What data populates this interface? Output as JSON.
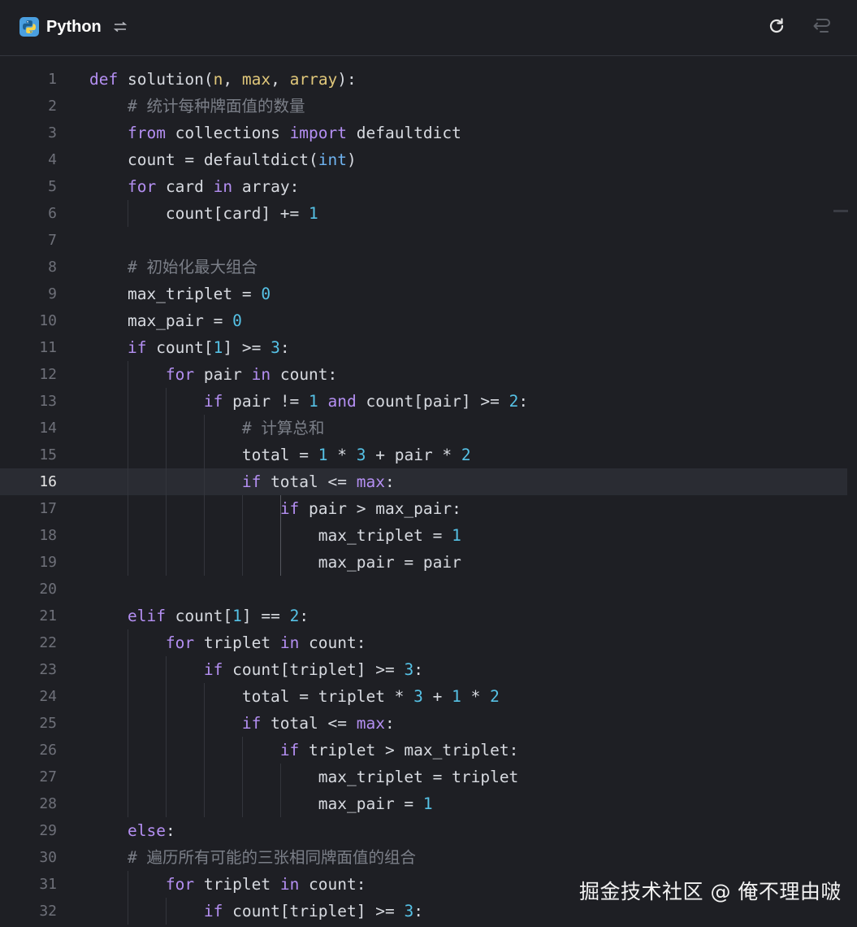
{
  "header": {
    "language": "Python",
    "icons": {
      "language": "python-logo-icon",
      "switch": "swap-icon",
      "refresh": "refresh-icon",
      "wrap": "word-wrap-icon"
    }
  },
  "editor": {
    "active_line": 16,
    "lines": [
      {
        "n": "1",
        "tokens": [
          [
            "k",
            "def "
          ],
          [
            "f",
            "solution("
          ],
          [
            "p",
            "n"
          ],
          [
            "f",
            ", "
          ],
          [
            "p",
            "max"
          ],
          [
            "f",
            ", "
          ],
          [
            "p",
            "array"
          ],
          [
            "f",
            "):"
          ]
        ]
      },
      {
        "n": "2",
        "tokens": [
          [
            "f",
            "    "
          ],
          [
            "c",
            "# 统计每种牌面值的数量"
          ]
        ]
      },
      {
        "n": "3",
        "tokens": [
          [
            "f",
            "    "
          ],
          [
            "k",
            "from"
          ],
          [
            "f",
            " collections "
          ],
          [
            "k",
            "import"
          ],
          [
            "f",
            " defaultdict"
          ]
        ]
      },
      {
        "n": "4",
        "tokens": [
          [
            "f",
            "    count = defaultdict("
          ],
          [
            "b",
            "int"
          ],
          [
            "f",
            ")"
          ]
        ]
      },
      {
        "n": "5",
        "tokens": [
          [
            "f",
            "    "
          ],
          [
            "k",
            "for"
          ],
          [
            "f",
            " card "
          ],
          [
            "k",
            "in"
          ],
          [
            "f",
            " array:"
          ]
        ]
      },
      {
        "n": "6",
        "tokens": [
          [
            "f",
            "        count[card] += "
          ],
          [
            "n",
            "1"
          ]
        ]
      },
      {
        "n": "7",
        "tokens": []
      },
      {
        "n": "8",
        "tokens": [
          [
            "f",
            "    "
          ],
          [
            "c",
            "# 初始化最大组合"
          ]
        ]
      },
      {
        "n": "9",
        "tokens": [
          [
            "f",
            "    max_triplet = "
          ],
          [
            "n",
            "0"
          ]
        ]
      },
      {
        "n": "10",
        "tokens": [
          [
            "f",
            "    max_pair = "
          ],
          [
            "n",
            "0"
          ]
        ]
      },
      {
        "n": "11",
        "tokens": [
          [
            "f",
            "    "
          ],
          [
            "k",
            "if"
          ],
          [
            "f",
            " count["
          ],
          [
            "n",
            "1"
          ],
          [
            "f",
            "] >= "
          ],
          [
            "n",
            "3"
          ],
          [
            "f",
            ":"
          ]
        ]
      },
      {
        "n": "12",
        "tokens": [
          [
            "f",
            "        "
          ],
          [
            "k",
            "for"
          ],
          [
            "f",
            " pair "
          ],
          [
            "k",
            "in"
          ],
          [
            "f",
            " count:"
          ]
        ]
      },
      {
        "n": "13",
        "tokens": [
          [
            "f",
            "            "
          ],
          [
            "k",
            "if"
          ],
          [
            "f",
            " pair != "
          ],
          [
            "n",
            "1"
          ],
          [
            "f",
            " "
          ],
          [
            "k",
            "and"
          ],
          [
            "f",
            " count[pair] >= "
          ],
          [
            "n",
            "2"
          ],
          [
            "f",
            ":"
          ]
        ]
      },
      {
        "n": "14",
        "tokens": [
          [
            "f",
            "                "
          ],
          [
            "c",
            "# 计算总和"
          ]
        ]
      },
      {
        "n": "15",
        "tokens": [
          [
            "f",
            "                total = "
          ],
          [
            "n",
            "1"
          ],
          [
            "f",
            " * "
          ],
          [
            "n",
            "3"
          ],
          [
            "f",
            " + pair * "
          ],
          [
            "n",
            "2"
          ]
        ]
      },
      {
        "n": "16",
        "tokens": [
          [
            "f",
            "                "
          ],
          [
            "k",
            "if"
          ],
          [
            "f",
            " total <= "
          ],
          [
            "k",
            "max"
          ],
          [
            "f",
            ":"
          ]
        ]
      },
      {
        "n": "17",
        "tokens": [
          [
            "f",
            "                    "
          ],
          [
            "k",
            "if"
          ],
          [
            "f",
            " pair > max_pair:"
          ]
        ]
      },
      {
        "n": "18",
        "tokens": [
          [
            "f",
            "                        max_triplet = "
          ],
          [
            "n",
            "1"
          ]
        ]
      },
      {
        "n": "19",
        "tokens": [
          [
            "f",
            "                        max_pair = pair"
          ]
        ]
      },
      {
        "n": "20",
        "tokens": []
      },
      {
        "n": "21",
        "tokens": [
          [
            "f",
            "    "
          ],
          [
            "k",
            "elif"
          ],
          [
            "f",
            " count["
          ],
          [
            "n",
            "1"
          ],
          [
            "f",
            "] == "
          ],
          [
            "n",
            "2"
          ],
          [
            "f",
            ":"
          ]
        ]
      },
      {
        "n": "22",
        "tokens": [
          [
            "f",
            "        "
          ],
          [
            "k",
            "for"
          ],
          [
            "f",
            " triplet "
          ],
          [
            "k",
            "in"
          ],
          [
            "f",
            " count:"
          ]
        ]
      },
      {
        "n": "23",
        "tokens": [
          [
            "f",
            "            "
          ],
          [
            "k",
            "if"
          ],
          [
            "f",
            " count[triplet] >= "
          ],
          [
            "n",
            "3"
          ],
          [
            "f",
            ":"
          ]
        ]
      },
      {
        "n": "24",
        "tokens": [
          [
            "f",
            "                total = triplet * "
          ],
          [
            "n",
            "3"
          ],
          [
            "f",
            " + "
          ],
          [
            "n",
            "1"
          ],
          [
            "f",
            " * "
          ],
          [
            "n",
            "2"
          ]
        ]
      },
      {
        "n": "25",
        "tokens": [
          [
            "f",
            "                "
          ],
          [
            "k",
            "if"
          ],
          [
            "f",
            " total <= "
          ],
          [
            "k",
            "max"
          ],
          [
            "f",
            ":"
          ]
        ]
      },
      {
        "n": "26",
        "tokens": [
          [
            "f",
            "                    "
          ],
          [
            "k",
            "if"
          ],
          [
            "f",
            " triplet > max_triplet:"
          ]
        ]
      },
      {
        "n": "27",
        "tokens": [
          [
            "f",
            "                        max_triplet = triplet"
          ]
        ]
      },
      {
        "n": "28",
        "tokens": [
          [
            "f",
            "                        max_pair = "
          ],
          [
            "n",
            "1"
          ]
        ]
      },
      {
        "n": "29",
        "tokens": [
          [
            "f",
            "    "
          ],
          [
            "k",
            "else"
          ],
          [
            "f",
            ":"
          ]
        ]
      },
      {
        "n": "30",
        "tokens": [
          [
            "f",
            "    "
          ],
          [
            "c",
            "# 遍历所有可能的三张相同牌面值的组合"
          ]
        ]
      },
      {
        "n": "31",
        "tokens": [
          [
            "f",
            "        "
          ],
          [
            "k",
            "for"
          ],
          [
            "f",
            " triplet "
          ],
          [
            "k",
            "in"
          ],
          [
            "f",
            " count:"
          ]
        ]
      },
      {
        "n": "32",
        "tokens": [
          [
            "f",
            "            "
          ],
          [
            "k",
            "if"
          ],
          [
            "f",
            " count[triplet] >= "
          ],
          [
            "n",
            "3"
          ],
          [
            "f",
            ":"
          ]
        ]
      }
    ]
  },
  "watermark": "掘金技术社区 @ 俺不理由啵"
}
